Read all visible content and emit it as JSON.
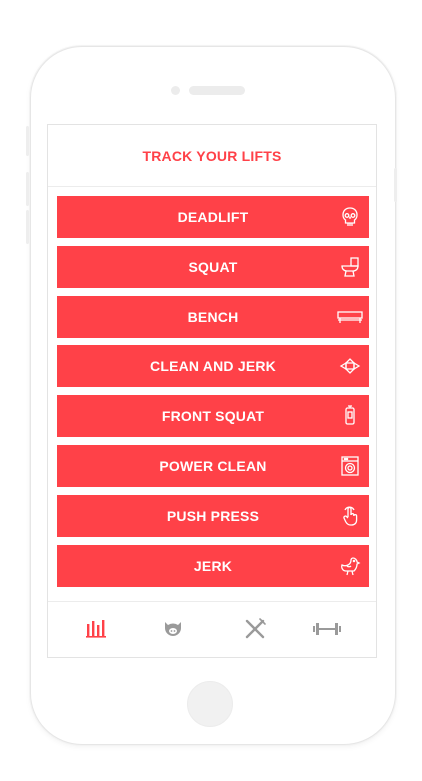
{
  "header": {
    "title": "TRACK YOUR LIFTS"
  },
  "lifts": [
    {
      "label": "DEADLIFT",
      "icon": "skull-icon"
    },
    {
      "label": "SQUAT",
      "icon": "toilet-icon"
    },
    {
      "label": "BENCH",
      "icon": "bench-icon"
    },
    {
      "label": "CLEAN AND JERK",
      "icon": "candy-icon"
    },
    {
      "label": "FRONT SQUAT",
      "icon": "phone-icon"
    },
    {
      "label": "POWER CLEAN",
      "icon": "washing-machine-icon"
    },
    {
      "label": "PUSH PRESS",
      "icon": "pointing-hand-icon"
    },
    {
      "label": "JERK",
      "icon": "chicken-icon"
    }
  ],
  "tabs": [
    {
      "icon": "bars-chart-icon",
      "active": true
    },
    {
      "icon": "pig-icon",
      "active": false
    },
    {
      "icon": "fork-knife-icon",
      "active": false
    },
    {
      "icon": "barbell-icon",
      "active": false
    }
  ],
  "colors": {
    "accent": "#ff4148",
    "inactive": "#9a9a9a",
    "border": "#e6e6e6"
  }
}
